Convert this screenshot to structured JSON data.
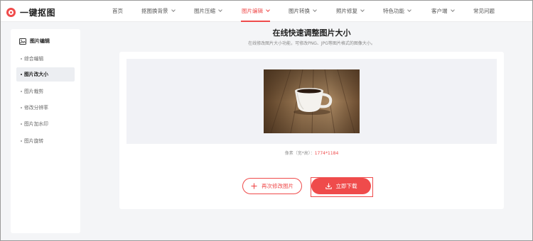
{
  "brand": {
    "name": "一键抠图",
    "color": "#ef4b4b"
  },
  "nav": {
    "items": [
      {
        "label": "首页",
        "has_dropdown": false,
        "active": false
      },
      {
        "label": "抠图换背景",
        "has_dropdown": true,
        "active": false
      },
      {
        "label": "图片压缩",
        "has_dropdown": true,
        "active": false
      },
      {
        "label": "图片编辑",
        "has_dropdown": true,
        "active": true
      },
      {
        "label": "图片转换",
        "has_dropdown": true,
        "active": false
      },
      {
        "label": "照片修复",
        "has_dropdown": true,
        "active": false
      },
      {
        "label": "特色功能",
        "has_dropdown": true,
        "active": false
      },
      {
        "label": "客户端",
        "has_dropdown": true,
        "active": false
      },
      {
        "label": "常见问题",
        "has_dropdown": false,
        "active": false
      }
    ]
  },
  "sidebar": {
    "title": "图片编辑",
    "icon": "image-edit-icon",
    "items": [
      {
        "label": "综合编辑",
        "active": false
      },
      {
        "label": "图片改大小",
        "active": true
      },
      {
        "label": "图片裁剪",
        "active": false
      },
      {
        "label": "修改分辨率",
        "active": false
      },
      {
        "label": "图片加水印",
        "active": false
      },
      {
        "label": "图片旋转",
        "active": false
      }
    ]
  },
  "main": {
    "title": "在线快速调整图片大小",
    "subtitle": "在线修改图片大小功能，可修改PNG、JPG等图片格式的图像大小。",
    "dims_label": "像素（宽*高）：",
    "dims_value": "1774*1184",
    "redo_button": "再次修改图片",
    "download_button": "立即下载"
  }
}
